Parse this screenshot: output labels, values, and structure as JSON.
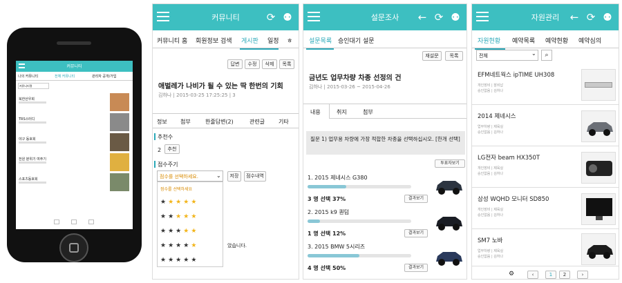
{
  "phone": {
    "title": "커뮤니티",
    "tabs": [
      "나의 커뮤니티",
      "전체 커뮤니티",
      "관리자 공개/가입"
    ],
    "filter": "커뮤니티명",
    "items": [
      {
        "name": "북한산우회"
      },
      {
        "name": "TRS스터디"
      },
      {
        "name": "야구 동호회"
      },
      {
        "name": "전원 분위기 여주기"
      },
      {
        "name": "스포츠동호회"
      }
    ]
  },
  "community": {
    "title": "커뮤니티",
    "tabs": [
      "커뮤니티 홈",
      "회원정보 검색",
      "게시판",
      "일정",
      "ㅎ"
    ],
    "buttons": [
      "답변",
      "수정",
      "삭제",
      "목록"
    ],
    "post_title": "애벌레가 나비가 될 수 있는 딱 한번의 기회",
    "post_meta": "김하나 | 2015-03-25 17:25:25 | 3",
    "sub_tabs": [
      "정보",
      "첨부",
      "한줄답변(2)",
      "관련글",
      "기타"
    ],
    "recommend_label": "추천수",
    "recommend_count": "2",
    "recommend_button": "추천",
    "score_label": "점수주기",
    "score_select": "점수를 선택하세요.",
    "save_button": "저장",
    "score_detail_button": "점수내역",
    "dropdown_header": "점수를 선택하세요",
    "star_rows": [
      "★★★★★",
      "★★★★★",
      "★★★★★",
      "★★★★★",
      "★★★★★"
    ],
    "star_levels": [
      1,
      2,
      3,
      4,
      5
    ],
    "partial_text": "았습니다."
  },
  "survey": {
    "title": "설문조사",
    "tabs": [
      "설문목록",
      "승인대기 설문"
    ],
    "buttons": [
      "재설문",
      "목록"
    ],
    "survey_title": "금년도 업무차량 차종 선정의 건",
    "period": "김하나 | 2015-03-26 ~ 2015-04-26",
    "sub_tabs": [
      "내용",
      "취지",
      "첨부"
    ],
    "question": "질문 1) 업무용 차량에 가장 적합한 차종을 선택하십시오. [한개 선택]",
    "respondent_button": "투표자보기",
    "options": [
      {
        "label": "1. 2015 제네시스 G380",
        "votes": "3 명 선택 37%",
        "pct": 37,
        "view": "결과보기"
      },
      {
        "label": "2. 2015 k9 퀀텀",
        "votes": "1 명 선택 12%",
        "pct": 12,
        "view": "결과보기"
      },
      {
        "label": "3. 2015 BMW 5시리즈",
        "votes": "4 명 선택 50%",
        "pct": 50,
        "view": "결과보기"
      }
    ]
  },
  "resource": {
    "title": "자원관리",
    "tabs": [
      "자원현황",
      "예약목록",
      "예약현황",
      "예약심의"
    ],
    "filter": "전체",
    "items": [
      {
        "name": "EFM네트웍스 ipTIME UH308",
        "meta1": "개인장비 | 잠비납",
        "meta2": "승인없음 | 김하나"
      },
      {
        "name": "2014 제네시스",
        "meta1": "업무차량 | 제육실",
        "meta2": "승인없음 | 김하나"
      },
      {
        "name": "LG전자 beam HX350T",
        "meta1": "개인장비 | 제육실",
        "meta2": "승인없음 | 김하나"
      },
      {
        "name": "삼성 WQHD 모니터 SD850",
        "meta1": "개인장비 | 제육실",
        "meta2": "승인없음 | 김하나"
      },
      {
        "name": "SM7 노바",
        "meta1": "업무차량 | 제육실",
        "meta2": "승인없음 | 김하나"
      }
    ],
    "pages": [
      "1",
      "2"
    ]
  },
  "colors": {
    "topbar": "#3dbfc1",
    "accent": "#2aa8b8",
    "star": "#f2b51b",
    "bar": "#89c7d6"
  }
}
